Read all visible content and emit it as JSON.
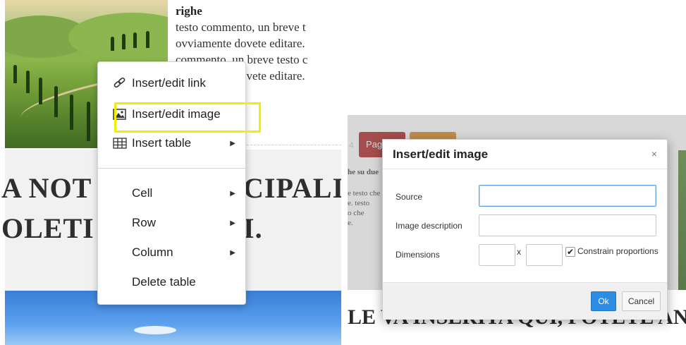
{
  "left": {
    "comment": {
      "title": "righe",
      "lines": [
        "testo commento, un breve t",
        "ovviamente dovete editare.",
        "commento, un breve testo c",
        "ovviamente dovete editare."
      ]
    },
    "heading": {
      "line1_left": "A NOT",
      "line1_right": "CIPALI",
      "line2_left": "OLETI",
      "line2_right": "I."
    },
    "context_menu": {
      "items": [
        {
          "label": "Insert/edit link",
          "icon": "link-icon"
        },
        {
          "label": "Insert/edit image",
          "icon": "image-icon"
        },
        {
          "label": "Insert table",
          "icon": "table-icon",
          "submenu": true
        },
        {
          "label": "Cell",
          "submenu": true
        },
        {
          "label": "Row",
          "submenu": true
        },
        {
          "label": "Column",
          "submenu": true
        },
        {
          "label": "Delete table"
        }
      ],
      "highlight_color": "#f2ee00"
    }
  },
  "right": {
    "toolbar": {
      "red_button_label": "Pagi",
      "red_color": "#b12a2a",
      "orange_color": "#d88a2a",
      "number": "4"
    },
    "side_text": {
      "title": "he su due",
      "lines": [
        "e testo che",
        "e. testo",
        "o che",
        "e."
      ]
    },
    "heading": "LE VA INSERITA QUI, POTETE ANDAR",
    "dialog": {
      "title": "Insert/edit image",
      "close": "×",
      "source_label": "Source",
      "source_value": "",
      "description_label": "Image description",
      "description_value": "",
      "dimensions_label": "Dimensions",
      "width_value": "",
      "height_value": "",
      "times": "x",
      "constrain_checked": true,
      "constrain_label": "Constrain proportions",
      "ok_label": "Ok",
      "cancel_label": "Cancel",
      "ok_color": "#2d8ce3"
    }
  }
}
